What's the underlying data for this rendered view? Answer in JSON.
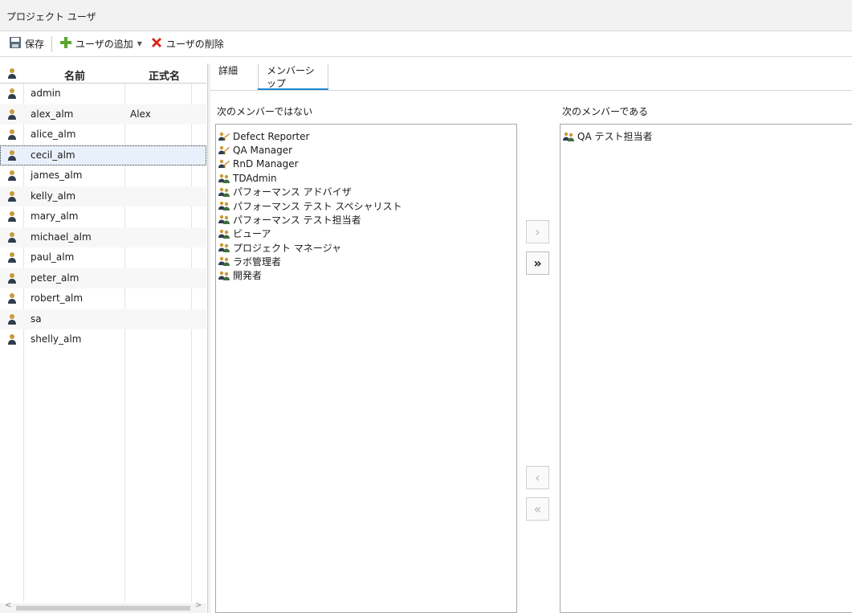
{
  "window": {
    "title": "プロジェクト ユーザ"
  },
  "toolbar": {
    "save_label": "保存",
    "add_user_label": "ユーザの追加",
    "delete_user_label": "ユーザの削除"
  },
  "user_table": {
    "columns": [
      "名前",
      "正式名"
    ],
    "rows": [
      {
        "name": "admin",
        "full_name": ""
      },
      {
        "name": "alex_alm",
        "full_name": "Alex"
      },
      {
        "name": "alice_alm",
        "full_name": ""
      },
      {
        "name": "cecil_alm",
        "full_name": ""
      },
      {
        "name": "james_alm",
        "full_name": ""
      },
      {
        "name": "kelly_alm",
        "full_name": ""
      },
      {
        "name": "mary_alm",
        "full_name": ""
      },
      {
        "name": "michael_alm",
        "full_name": ""
      },
      {
        "name": "paul_alm",
        "full_name": ""
      },
      {
        "name": "peter_alm",
        "full_name": ""
      },
      {
        "name": "robert_alm",
        "full_name": ""
      },
      {
        "name": "sa",
        "full_name": ""
      },
      {
        "name": "shelly_alm",
        "full_name": ""
      }
    ],
    "selected_row": "cecil_alm"
  },
  "tabs": [
    {
      "label": "詳細",
      "active": false
    },
    {
      "label": "メンバーシップ",
      "active": true
    }
  ],
  "membership": {
    "not_member_label": "次のメンバーではない",
    "member_label": "次のメンバーである",
    "not_member_of": [
      {
        "label": "Defect Reporter",
        "icon": "group-role-icon"
      },
      {
        "label": "QA Manager",
        "icon": "group-role-icon"
      },
      {
        "label": "RnD Manager",
        "icon": "group-role-icon"
      },
      {
        "label": "TDAdmin",
        "icon": "group-icon"
      },
      {
        "label": "パフォーマンス アドバイザ",
        "icon": "group-icon"
      },
      {
        "label": "パフォーマンス テスト スペシャリスト",
        "icon": "group-icon"
      },
      {
        "label": "パフォーマンス テスト担当者",
        "icon": "group-icon"
      },
      {
        "label": "ビューア",
        "icon": "group-icon"
      },
      {
        "label": "プロジェクト マネージャ",
        "icon": "group-icon"
      },
      {
        "label": "ラボ管理者",
        "icon": "group-icon"
      },
      {
        "label": "開発者",
        "icon": "group-icon"
      }
    ],
    "member_of": [
      {
        "label": "QA テスト担当者",
        "icon": "group-icon"
      }
    ],
    "buttons": {
      "add_one": "›",
      "add_all": "»",
      "remove_one": "‹",
      "remove_all": "«"
    }
  },
  "colors": {
    "accent": "#1e8ad6",
    "selection": "#e8f1fb",
    "delete_red": "#d9251c",
    "add_green": "#5aa632"
  }
}
